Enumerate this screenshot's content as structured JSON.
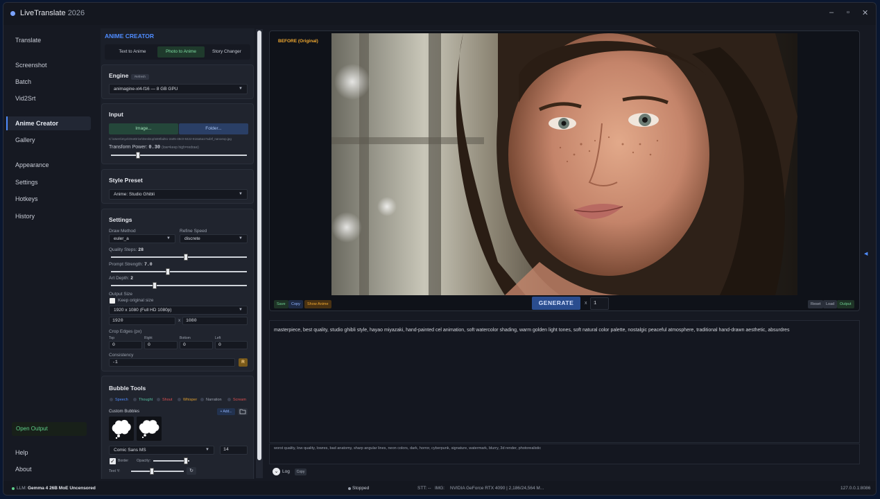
{
  "window": {
    "title": "LiveTranslate",
    "title_year": "2026",
    "minimize": "–",
    "maximize": "▫",
    "close": "✕"
  },
  "sidebar": {
    "items": [
      {
        "label": "Translate"
      },
      {
        "label": "Screenshot"
      },
      {
        "label": "Batch"
      },
      {
        "label": "Vid2Srt"
      },
      {
        "label": "Anime Creator"
      },
      {
        "label": "Gallery"
      },
      {
        "label": "Appearance"
      },
      {
        "label": "Settings"
      },
      {
        "label": "Hotkeys"
      },
      {
        "label": "History"
      }
    ],
    "active_item": "Anime Creator",
    "open_output_label": "Open Output",
    "help_label": "Help",
    "about_label": "About"
  },
  "panel": {
    "header": "ANIME CREATOR",
    "tabs": [
      {
        "label": "Text to Anime"
      },
      {
        "label": "Photo to Anime",
        "active": true
      },
      {
        "label": "Story Changer"
      }
    ],
    "engine": {
      "title": "Engine",
      "refresh_label": "Refresh",
      "selected": "animagine-xl4-f16 — 8 GB GPU"
    },
    "input": {
      "title": "Input",
      "image_button": "Image...",
      "folder_button": "Folder...",
      "path": "C:\\Users\\myo\\OneDrive\\Desktop\\669fad51-2a05-48c0-8422-816a5a17ad3f_nanoexp.jpg",
      "transform_label": "Transform Power:",
      "transform_value": "0.30",
      "transform_hint": "(low=keep high=redraw)",
      "transform_fraction": 0.2
    },
    "style_preset": {
      "title": "Style Preset",
      "selected": "Anime: Studio Ghibli"
    },
    "settings": {
      "title": "Settings",
      "draw_method_label": "Draw Method",
      "draw_method": "euler_a",
      "refine_speed_label": "Refine Speed",
      "refine_speed": "discrete",
      "quality_steps_label": "Quality Steps:",
      "quality_steps": "28",
      "quality_fraction": 0.55,
      "prompt_strength_label": "Prompt Strength:",
      "prompt_strength": "7.0",
      "prompt_fraction": 0.42,
      "art_depth_label": "Art Depth:",
      "art_depth": "2",
      "art_fraction": 0.32,
      "output_size_label": "Output Size",
      "keep_original_label": "Keep original size",
      "keep_original_checked": false,
      "resolution": "1920 x 1080 (Full HD 1080p)",
      "width": "1920",
      "height": "1080",
      "times": "x",
      "crop_label": "Crop Edges (px)",
      "crop": [
        {
          "label": "Top",
          "value": "0"
        },
        {
          "label": "Right",
          "value": "0"
        },
        {
          "label": "Bottom",
          "value": "0"
        },
        {
          "label": "Left",
          "value": "0"
        }
      ],
      "consistency_label": "Consistency",
      "consistency": "-1",
      "random_label": "R"
    },
    "bubble_tools": {
      "title": "Bubble Tools",
      "types": [
        {
          "label": "Speech",
          "color": "#4f8cff"
        },
        {
          "label": "Thought",
          "color": "#56c0a0"
        },
        {
          "label": "Shout",
          "color": "#e05050"
        },
        {
          "label": "Whisper",
          "color": "#e0a030"
        },
        {
          "label": "Narration",
          "color": "#9aa1ad"
        },
        {
          "label": "Scream",
          "color": "#e05050"
        }
      ],
      "custom_label": "Custom Bubbles",
      "add_label": "+ Add...",
      "font": "Comic Sans MS",
      "font_size": "14",
      "border_label": "Border",
      "border_checked": true,
      "opacity_label": "Opacity:",
      "opacity_fraction": 0.9,
      "text_y_label": "Text Y:",
      "text_y_fraction": 0.4
    }
  },
  "preview": {
    "before_label": "BEFORE (Original)",
    "save_label": "Save",
    "copy_label": "Copy",
    "show_anime_label": "Show Anime",
    "generate_label": "GENERATE",
    "times": "x",
    "count": "1",
    "reset_label": "Reset",
    "load_label": "Load",
    "output_label": "Output"
  },
  "prompt": "masterpiece, best quality, studio ghibli style, hayao miyazaki, hand-painted cel animation, soft watercolor shading, warm golden light tones, soft natural color palette, nostalgic peaceful atmosphere, traditional hand-drawn aesthetic, absurdres",
  "negative_prompt": "worst quality, low quality, lowres, bad anatomy, sharp angular lines, neon colors, dark, horror, cyberpunk, signature, watermark, blurry, 3d render, photorealistic",
  "log": {
    "label": "Log",
    "copy_label": "Copy"
  },
  "status": {
    "llm_label": "LLM:",
    "llm_model": "Gemma 4 26B MoE Uncensored",
    "state": "Stopped",
    "stt": "STT: --",
    "img": "IMG:",
    "gpu": "NVIDIA GeForce RTX 4090 | 2,186/24,564 M...",
    "address": "127.0.0.1:8086"
  },
  "colors": {
    "accent": "#4f8cff",
    "green": "#5fd08a",
    "orange": "#f0a830",
    "generate": "#2a4d8f"
  }
}
